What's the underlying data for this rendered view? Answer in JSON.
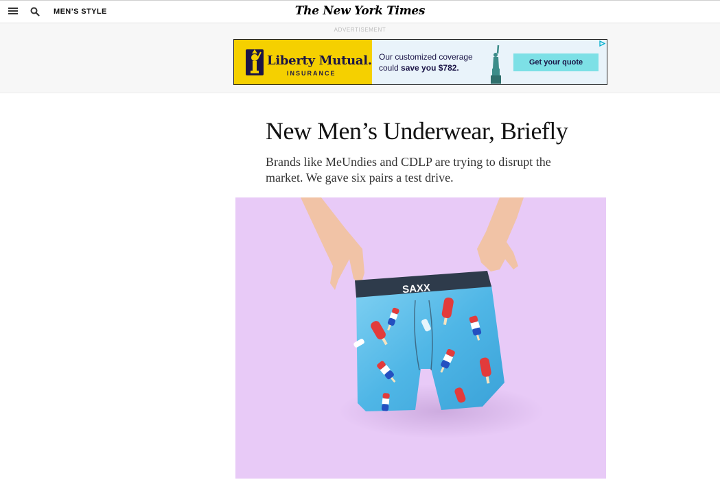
{
  "header": {
    "section": "MEN’S STYLE",
    "masthead": "The New York Times"
  },
  "ad": {
    "label": "ADVERTISEMENT",
    "brand": "Liberty Mutual.",
    "brand_sub": "INSURANCE",
    "copy_line1": "Our customized coverage",
    "copy_line2_prefix": "could ",
    "copy_line2_bold": "save you $782.",
    "cta": "Get your quote"
  },
  "article": {
    "headline": "New Men’s Underwear, Briefly",
    "summary": "Brands like MeUndies and CDLP are trying to disrupt the market. We gave six pairs a test drive."
  },
  "hero": {
    "waistband_text": "SAXX"
  },
  "colors": {
    "hero_bg": "#e8caf7",
    "ad_yellow": "#f5d000",
    "ad_navy": "#1a1446",
    "cta_bg": "#7de0e6",
    "fabric": "#4fb6e6"
  },
  "icons": [
    "menu-icon",
    "search-icon",
    "liberty-logo-icon",
    "statue-icon",
    "adchoices-icon"
  ]
}
